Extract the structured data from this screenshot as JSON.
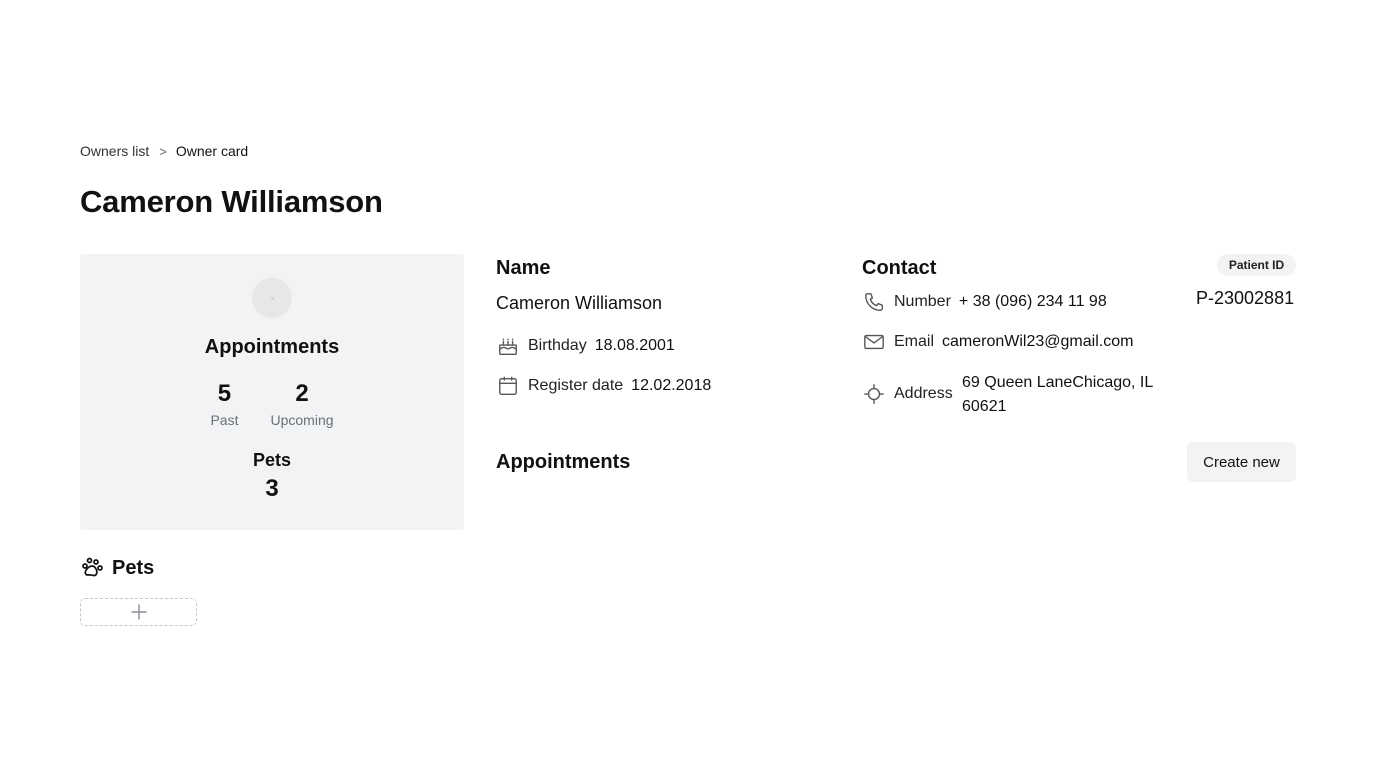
{
  "breadcrumb": {
    "parent": "Owners list",
    "separator": ">",
    "current": "Owner card"
  },
  "page_title": "Cameron Williamson",
  "summary": {
    "appointments_title": "Appointments",
    "past_count": "5",
    "past_label": "Past",
    "upcoming_count": "2",
    "upcoming_label": "Upcoming",
    "pets_title": "Pets",
    "pets_count": "3"
  },
  "name_section": {
    "title": "Name",
    "value": "Cameron Williamson",
    "birthday_label": "Birthday",
    "birthday_value": "18.08.2001",
    "register_label": "Register date",
    "register_value": "12.02.2018"
  },
  "contact": {
    "title": "Contact",
    "number_label": "Number",
    "number_value": "+ 38 (096) 234 11 98",
    "email_label": "Email",
    "email_value": "cameronWil23@gmail.com",
    "address_label": "Address",
    "address_value": "69 Queen LaneChicago, IL 60621"
  },
  "patient": {
    "badge": "Patient ID",
    "id": "P-23002881"
  },
  "appointments_section": {
    "title": "Appointments",
    "create_label": "Create new"
  },
  "pets_section": {
    "title": "Pets"
  },
  "icons": [
    "cake-icon",
    "calendar-icon",
    "phone-icon",
    "mail-icon",
    "location-icon",
    "paw-icon",
    "plus-icon"
  ]
}
